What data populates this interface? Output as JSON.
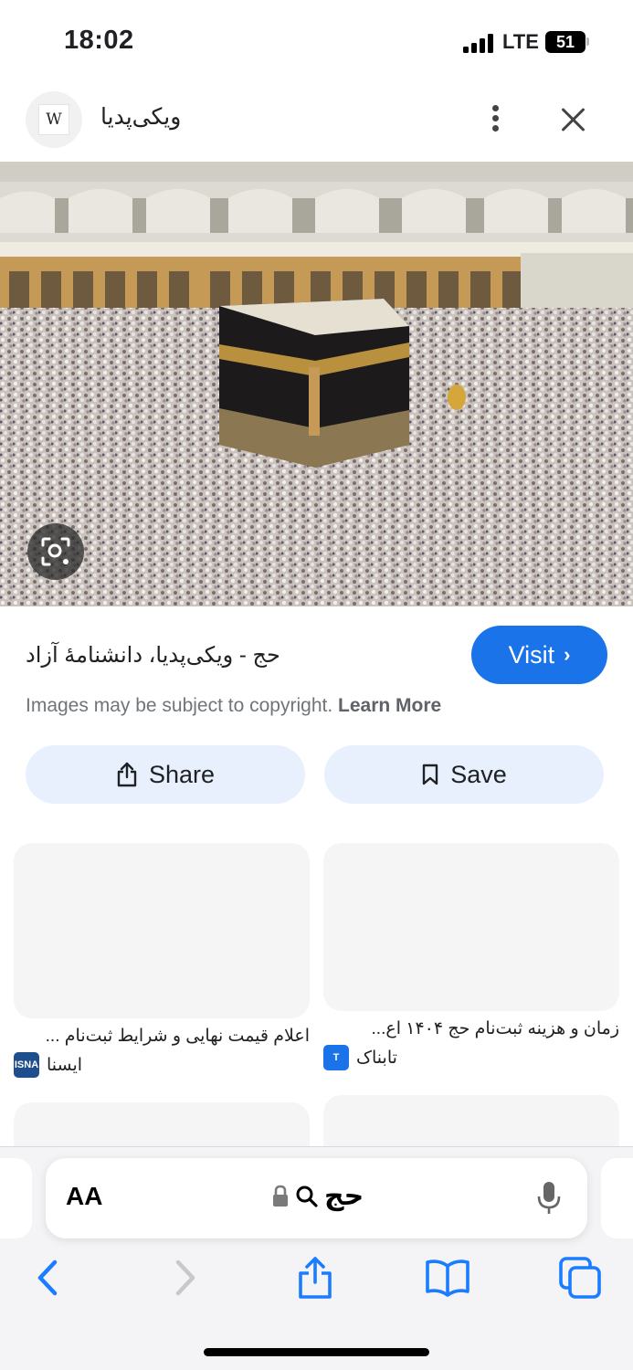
{
  "status_bar": {
    "time": "18:02",
    "network": "LTE",
    "battery": "51",
    "battery_level": 0.51
  },
  "header": {
    "site_name": "ویکی‌پدیا",
    "favicon_letter": "W",
    "icons": {
      "more": "more-vertical-icon",
      "close": "close-icon"
    }
  },
  "image": {
    "description_icon": "lens-search-icon"
  },
  "result": {
    "title": "حج - ویکی‌پدیا، دانشنامهٔ آزاد",
    "visit_label": "Visit",
    "copyright_text": "Images may be subject to copyright.",
    "learn_more": "Learn More",
    "share_label": "Share",
    "save_label": "Save"
  },
  "related": [
    {
      "title": "اعلام قیمت نهایی و شرایط ثبت‌نام ...",
      "source": "ایسنا",
      "source_color": "#1f4e8c"
    },
    {
      "title": "زمان و هزینه ثبت‌نام حج ۱۴۰۴ اع...",
      "source": "تابناک",
      "source_color": "#1a73e8"
    }
  ],
  "browser": {
    "aa_label": "AA",
    "query": "حج",
    "icons": [
      "back-icon",
      "forward-icon",
      "share-icon",
      "bookmarks-icon",
      "tabs-icon"
    ]
  },
  "colors": {
    "accent": "#1a73e8",
    "pill_bg": "#e8f0fe",
    "toolbar_blue": "#1a7cff"
  }
}
